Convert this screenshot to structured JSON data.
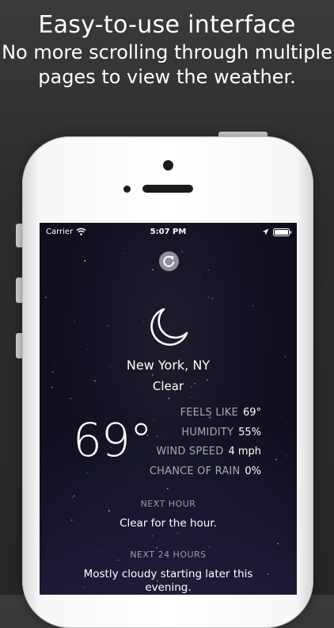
{
  "promo": {
    "headline": "Easy-to-use interface",
    "subline": "No more scrolling through multiple pages to view the weather."
  },
  "status_bar": {
    "carrier": "Carrier",
    "time": "5:07 PM",
    "icons": [
      "wifi-icon",
      "location-arrow-icon",
      "battery-icon"
    ]
  },
  "weather": {
    "refresh_icon": "refresh-icon",
    "condition_icon": "moon-icon",
    "city": "New York, NY",
    "condition": "Clear",
    "temperature": "69°",
    "stats": [
      {
        "label": "FEELS LIKE",
        "value": "69°"
      },
      {
        "label": "HUMIDITY",
        "value": "55%"
      },
      {
        "label": "WIND SPEED",
        "value": "4 mph"
      },
      {
        "label": "CHANCE OF RAIN",
        "value": "0%"
      }
    ],
    "next_hour": {
      "heading": "NEXT HOUR",
      "summary": "Clear for the hour."
    },
    "next_24_hours": {
      "heading": "NEXT 24 HOURS",
      "summary": "Mostly cloudy starting later this evening."
    }
  },
  "colors": {
    "background": "#2b2b2b",
    "screen": "#121222",
    "accent_gray": "#8e8e96",
    "label_gray": "#a7a7b4"
  }
}
